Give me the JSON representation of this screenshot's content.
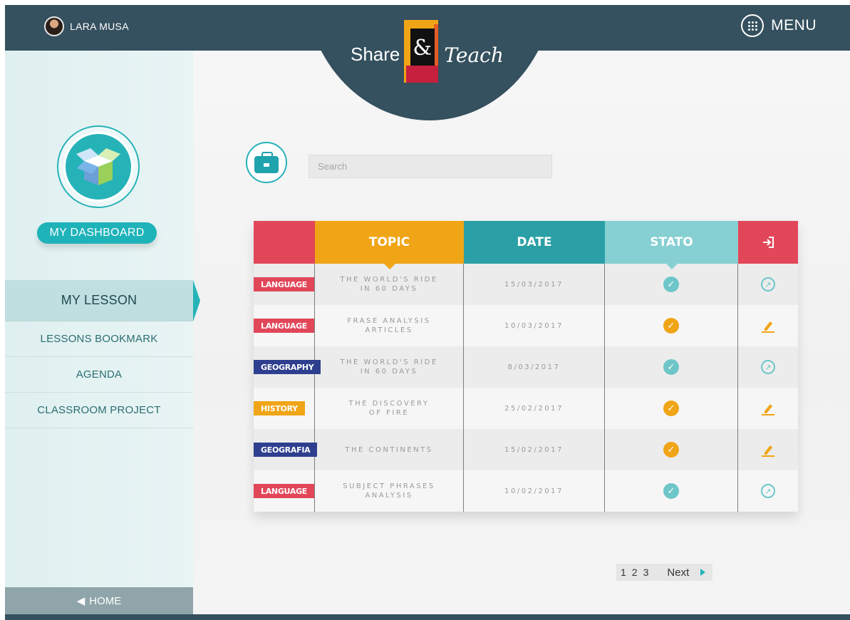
{
  "user": {
    "name": "LARA MUSA"
  },
  "menu": {
    "label": "MENU",
    "icon": "grid-dots-icon"
  },
  "logo": {
    "left": "Share",
    "glyph": "&",
    "right": "Teach"
  },
  "sidebar": {
    "dashboard_label": "MY DASHBOARD",
    "items": [
      {
        "label": "MY LESSON",
        "active": true
      },
      {
        "label": "LESSONS BOOKMARK"
      },
      {
        "label": "AGENDA"
      },
      {
        "label": "CLASSROOM PROJECT"
      }
    ],
    "home_label": "HOME"
  },
  "search": {
    "placeholder": "Search",
    "value": ""
  },
  "table": {
    "headers": {
      "topic": "TOPIC",
      "date": "DATE",
      "stato": "STATO",
      "action_icon": "enter-icon"
    },
    "rows": [
      {
        "subject": "LANGUAGE",
        "subject_color": "#e24659",
        "topic": "THE WORLD'S RIDE\nIN 60 DAYS",
        "date": "15/03/2017",
        "status": "done",
        "status_color": "#6ec6c9",
        "action": "open"
      },
      {
        "subject": "LANGUAGE",
        "subject_color": "#e24659",
        "topic": "FRASE ANALYSIS\nARTICLES",
        "date": "10/03/2017",
        "status": "pending",
        "status_color": "#f0a516",
        "action": "edit"
      },
      {
        "subject": "GEOGRAPHY",
        "subject_color": "#2e3f8f",
        "topic": "THE WORLD'S RIDE\nIN 60 DAYS",
        "date": "8/03/2017",
        "status": "done",
        "status_color": "#6ec6c9",
        "action": "open"
      },
      {
        "subject": "HISTORY",
        "subject_color": "#f0a516",
        "topic": "THE DISCOVERY\nOF FIRE",
        "date": "25/02/2017",
        "status": "pending",
        "status_color": "#f0a516",
        "action": "edit"
      },
      {
        "subject": "GEOGRAFIA",
        "subject_color": "#2e3f8f",
        "topic": "THE CONTINENTS",
        "date": "15/02/2017",
        "status": "pending",
        "status_color": "#f0a516",
        "action": "edit"
      },
      {
        "subject": "LANGUAGE",
        "subject_color": "#e24659",
        "topic": "SUBJECT PHRASES\nANALYSIS",
        "date": "10/02/2017",
        "status": "done",
        "status_color": "#6ec6c9",
        "action": "open"
      }
    ]
  },
  "pagination": {
    "pages": [
      "1",
      "2",
      "3"
    ],
    "next_label": "Next"
  },
  "colors": {
    "navy": "#35505e",
    "teal": "#26b3b8",
    "orange": "#f0a516",
    "red": "#e24659"
  }
}
